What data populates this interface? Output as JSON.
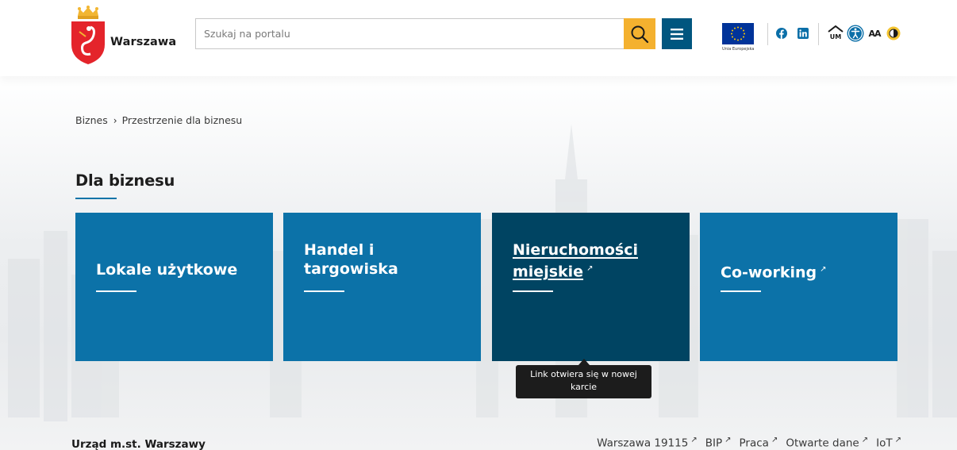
{
  "header": {
    "logo_text": "Warszawa",
    "search": {
      "placeholder": "Szukaj na portalu",
      "value": ""
    },
    "eu_caption": "Unia Europejska",
    "social": [
      "facebook-icon",
      "linkedin-icon"
    ],
    "tools": [
      "um-icon",
      "accessibility-icon",
      "font-size-icon",
      "contrast-icon"
    ],
    "tools_labels": {
      "font_size": "AA"
    },
    "colors": {
      "accent": "#f4b12f",
      "primary": "#00567f"
    }
  },
  "breadcrumb": {
    "items": [
      "Biznes",
      "Przestrzenie dla biznesu"
    ],
    "separator": "›"
  },
  "main": {
    "title": "Dla biznesu",
    "tiles": [
      {
        "label": "Lokale użytkowe",
        "external": false
      },
      {
        "label_line1": "Handel i",
        "label_line2": "targowiska",
        "external": false
      },
      {
        "label_line1": "Nieruchomości",
        "label_line2": "miejskie",
        "external": true
      },
      {
        "label": "Co-working",
        "external": true
      }
    ],
    "tile_colors": {
      "default": "#0c72a8",
      "active": "#004462"
    }
  },
  "tooltip": {
    "line1": "Link otwiera się w nowej",
    "line2": "karcie"
  },
  "footer": {
    "org": "Urząd m.st. Warszawy",
    "links": [
      "Warszawa 19115",
      "BIP",
      "Praca",
      "Otwarte dane",
      "IoT"
    ],
    "external_glyph": "↗"
  }
}
